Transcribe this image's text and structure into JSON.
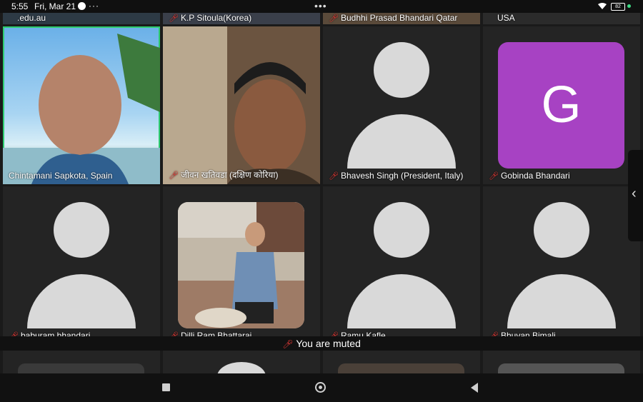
{
  "status_bar": {
    "time": "5:55",
    "date": "Fri, Mar 21",
    "more": "···",
    "center_menu": "•••",
    "battery": "82"
  },
  "top_row_labels": [
    ".edu.au",
    "K.P Sitoula(Korea)",
    "Budhhi Prasad Bhandari Qatar",
    "USA"
  ],
  "participants": [
    {
      "name": "Chintamani Sapkota, Spain",
      "muted": false
    },
    {
      "name": "जीवन खतिवडा (दक्षिण कोरिया)",
      "muted": true
    },
    {
      "name": "Bhavesh Singh (President, Italy)",
      "muted": true
    },
    {
      "name": "Gobinda Bhandari",
      "muted": true,
      "initial": "G",
      "color": "#a742c3"
    },
    {
      "name": "baburam bhandari",
      "muted": true
    },
    {
      "name": "Dilli Ram Bhattarai",
      "muted": true
    },
    {
      "name": "Ramu Kafle",
      "muted": true
    },
    {
      "name": "Bhuvan Bimali",
      "muted": true
    }
  ],
  "muted_notice": "You are muted",
  "colors": {
    "active_speaker": "#2ecc71",
    "muted_icon": "#e53935"
  }
}
